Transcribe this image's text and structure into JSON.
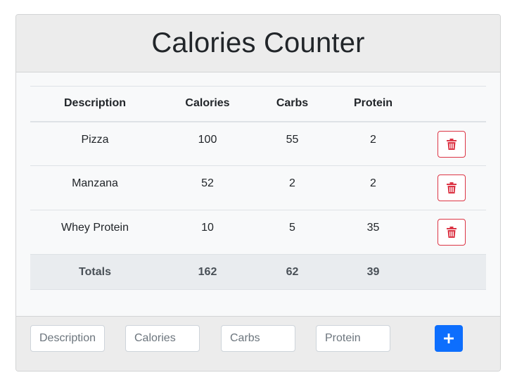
{
  "header": {
    "title": "Calories Counter"
  },
  "table": {
    "columns": [
      "Description",
      "Calories",
      "Carbs",
      "Protein"
    ],
    "rows": [
      {
        "description": "Pizza",
        "calories": "100",
        "carbs": "55",
        "protein": "2"
      },
      {
        "description": "Manzana",
        "calories": "52",
        "carbs": "2",
        "protein": "2"
      },
      {
        "description": "Whey Protein",
        "calories": "10",
        "carbs": "5",
        "protein": "35"
      }
    ],
    "totals": {
      "label": "Totals",
      "calories": "162",
      "carbs": "62",
      "protein": "39"
    },
    "delete_icon": "trash-icon"
  },
  "form": {
    "description_placeholder": "Description",
    "calories_placeholder": "Calories",
    "carbs_placeholder": "Carbs",
    "protein_placeholder": "Protein",
    "add_icon": "plus-icon"
  },
  "colors": {
    "danger": "#dc3545",
    "primary": "#0d6efd",
    "header_bg": "#ececec",
    "totals_bg": "#e9ecef"
  }
}
